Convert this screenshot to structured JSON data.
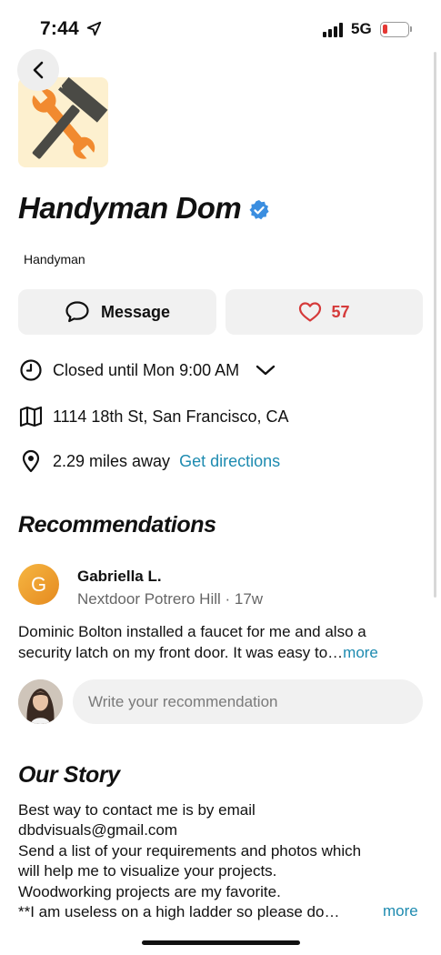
{
  "status_bar": {
    "time": "7:44",
    "network": "5G",
    "battery_color": "#e53935"
  },
  "business": {
    "name": "Handyman Dom",
    "category": "Handyman",
    "verified": true,
    "logo_icon": "hammer-wrench-icon"
  },
  "actions": {
    "message_label": "Message",
    "like_count": "57"
  },
  "info": {
    "hours": "Closed until Mon 9:00 AM",
    "address": "1114 18th St, San Francisco, CA",
    "distance": "2.29 miles away",
    "directions_label": "Get directions"
  },
  "recommendations": {
    "title": "Recommendations",
    "item": {
      "avatar_initial": "G",
      "author": "Gabriella L.",
      "meta": "Nextdoor Potrero Hill · 17w",
      "text_line1": "Dominic Bolton installed a faucet for me and also a",
      "text_line2": "security latch on my front door. It was easy to…",
      "more_label": "more"
    },
    "input_placeholder": "Write your recommendation"
  },
  "story": {
    "title": "Our Story",
    "lines": [
      "Best way to contact me is by email",
      "dbdvisuals@gmail.com",
      "Send a list of your requirements and photos which",
      "will help me to visualize your projects.",
      "Woodworking projects are my favorite.",
      "**I am useless on a high ladder so please do…"
    ],
    "more_label": "more"
  },
  "colors": {
    "accent_link": "#1e8bb0",
    "like_red": "#d53a3a",
    "verified_blue": "#3b8ee0",
    "logo_bg": "#fdf0cf"
  }
}
